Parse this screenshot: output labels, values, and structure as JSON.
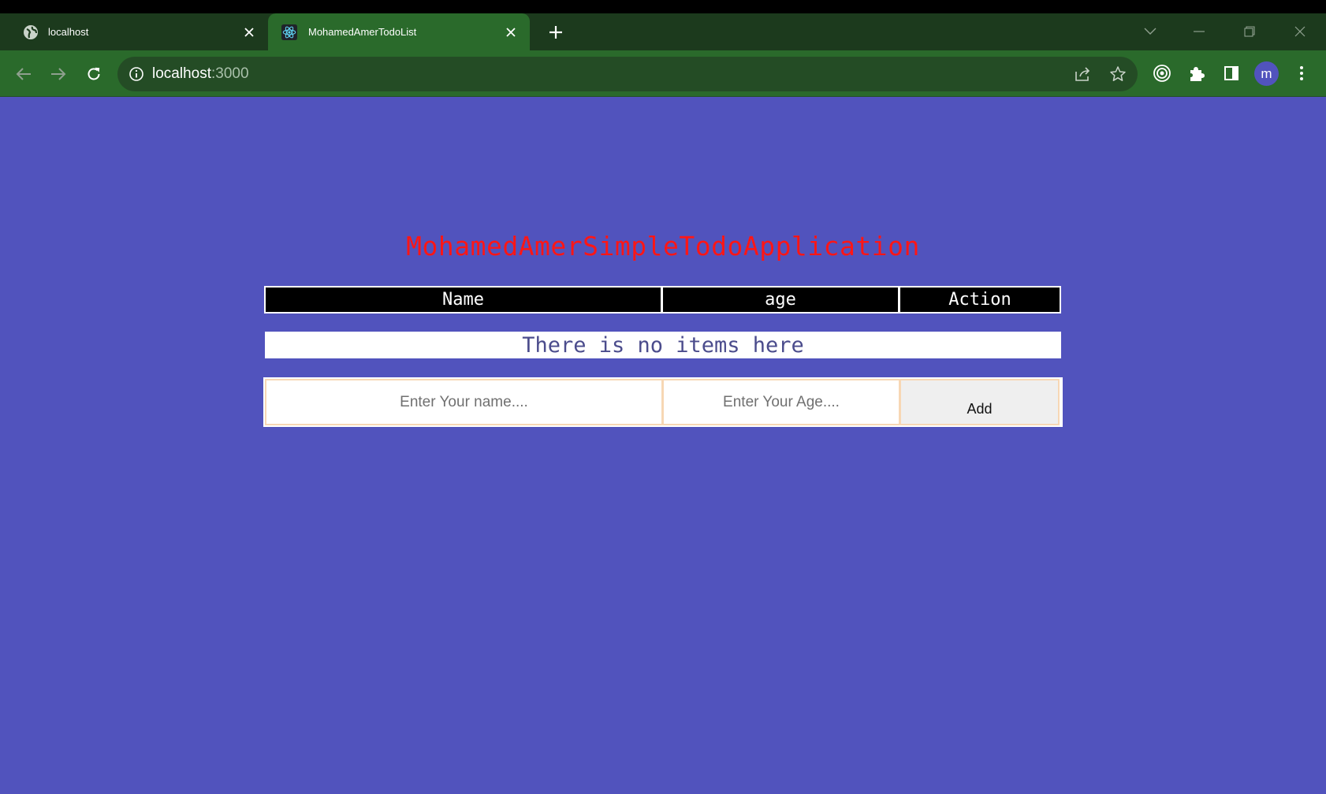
{
  "browser": {
    "tabs": [
      {
        "title": "localhost",
        "active": false,
        "favicon": "globe-icon"
      },
      {
        "title": "MohamedAmerTodoList",
        "active": true,
        "favicon": "react-icon"
      }
    ],
    "address_bar": {
      "host": "localhost",
      "port": ":3000"
    },
    "profile_initial": "m",
    "colors": {
      "frame": "#1c3a1d",
      "toolbar": "#2a6a2b",
      "page_bg": "#5153bd"
    }
  },
  "app": {
    "title": "MohamedAmerSimpleTodoApplication",
    "title_color": "#ff1616",
    "table_headers": {
      "name": "Name",
      "age": "age",
      "action": "Action"
    },
    "empty_message": "There is no items here",
    "form": {
      "name_placeholder": "Enter Your name....",
      "age_placeholder": "Enter Your Age....",
      "add_label": "Add"
    }
  }
}
